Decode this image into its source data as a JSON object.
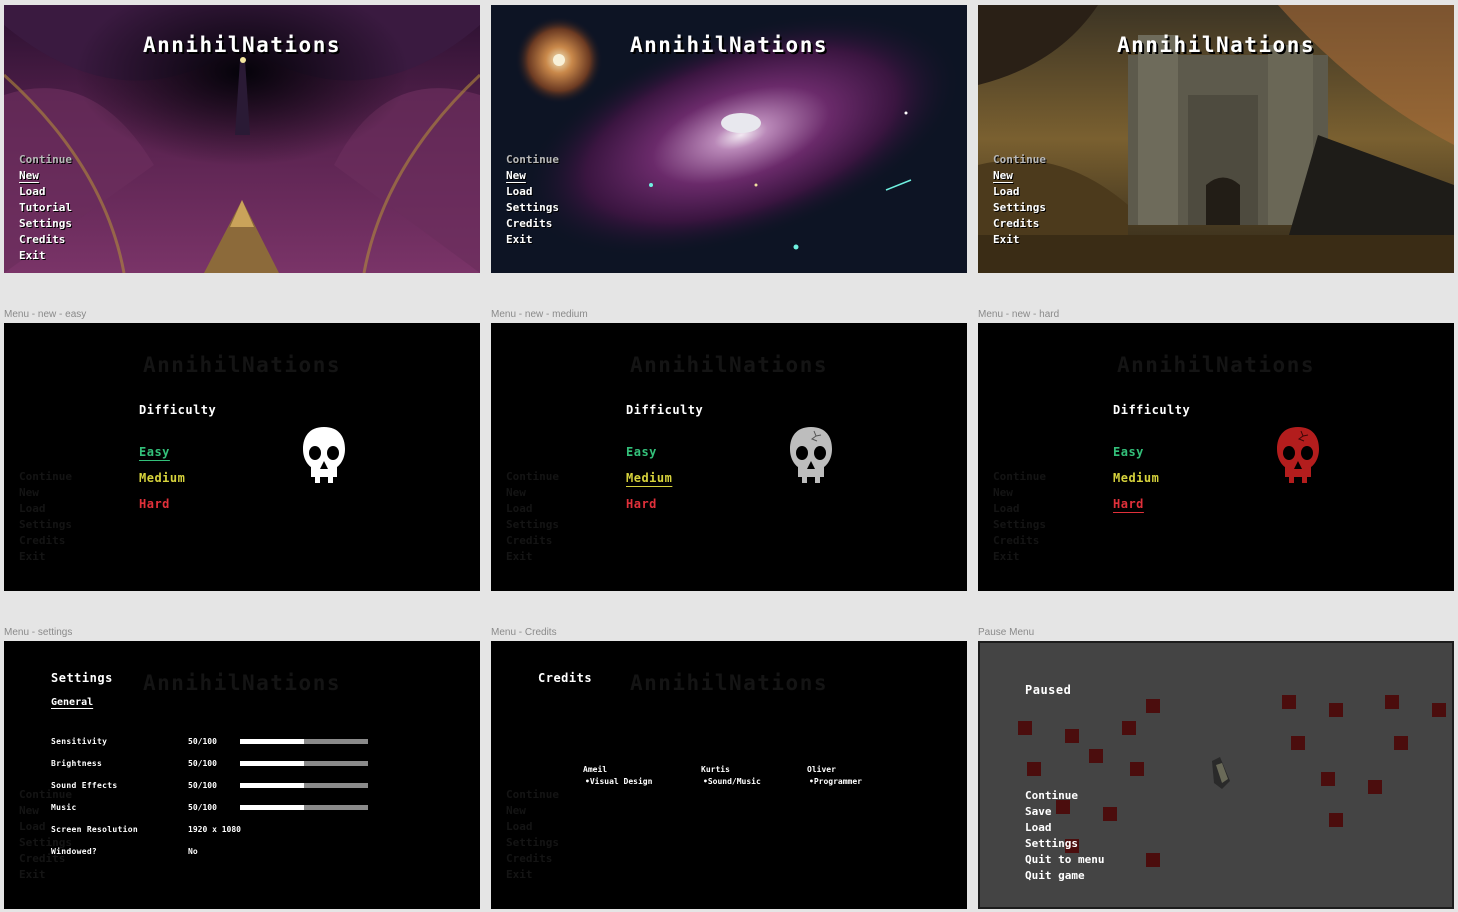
{
  "frames": {
    "bg01": {
      "title": "AnnihilNations",
      "menu": [
        "Continue",
        "New",
        "Load",
        "Tutorial",
        "Settings",
        "Credits",
        "Exit"
      ]
    },
    "bg02": {
      "title": "AnnihilNations",
      "menu": [
        "Continue",
        "New",
        "Load",
        "Settings",
        "Credits",
        "Exit"
      ]
    },
    "bg03": {
      "title": "AnnihilNations",
      "menu": [
        "Continue",
        "New",
        "Load",
        "Settings",
        "Credits",
        "Exit"
      ]
    },
    "easy": {
      "label": "Menu - new - easy",
      "title": "AnnihilNations",
      "heading": "Difficulty",
      "options": [
        "Easy",
        "Medium",
        "Hard"
      ],
      "selected": "Easy",
      "skull_color": "#ffffff"
    },
    "medium": {
      "label": "Menu - new - medium",
      "title": "AnnihilNations",
      "heading": "Difficulty",
      "options": [
        "Easy",
        "Medium",
        "Hard"
      ],
      "selected": "Medium",
      "skull_color": "#bdbdbd"
    },
    "hard": {
      "label": "Menu - new - hard",
      "title": "AnnihilNations",
      "heading": "Difficulty",
      "options": [
        "Easy",
        "Medium",
        "Hard"
      ],
      "selected": "Hard",
      "skull_color": "#b31d1d"
    },
    "settings": {
      "label": "Menu - settings",
      "title": "AnnihilNations",
      "heading": "Settings",
      "tab": "General",
      "rows": [
        {
          "label": "Sensitivity",
          "value": "50/100",
          "level": 0.5
        },
        {
          "label": "Brightness",
          "value": "50/100",
          "level": 0.5
        },
        {
          "label": "Sound Effects",
          "value": "50/100",
          "level": 0.5
        },
        {
          "label": "Music",
          "value": "50/100",
          "level": 0.5
        },
        {
          "label": "Screen Resolution",
          "value": "1920 x 1080"
        },
        {
          "label": "Windowed?",
          "value": "No"
        }
      ]
    },
    "credits": {
      "label": "Menu - Credits",
      "title": "AnnihilNations",
      "heading": "Credits",
      "people": [
        {
          "name": "Ameil",
          "role": "•Visual Design"
        },
        {
          "name": "Kurtis",
          "role": "•Sound/Music"
        },
        {
          "name": "Oliver",
          "role": "•Programmer"
        }
      ]
    },
    "pause": {
      "label": "Pause Menu",
      "heading": "Paused",
      "menu": [
        "Continue",
        "Save",
        "Load",
        "Settings",
        "Quit to menu",
        "Quit game"
      ]
    }
  },
  "colors": {
    "easy": "#33c07a",
    "medium": "#d6d23c",
    "hard": "#e0303a",
    "canvas": "#e5e5e5",
    "pause_bg": "#444444"
  }
}
